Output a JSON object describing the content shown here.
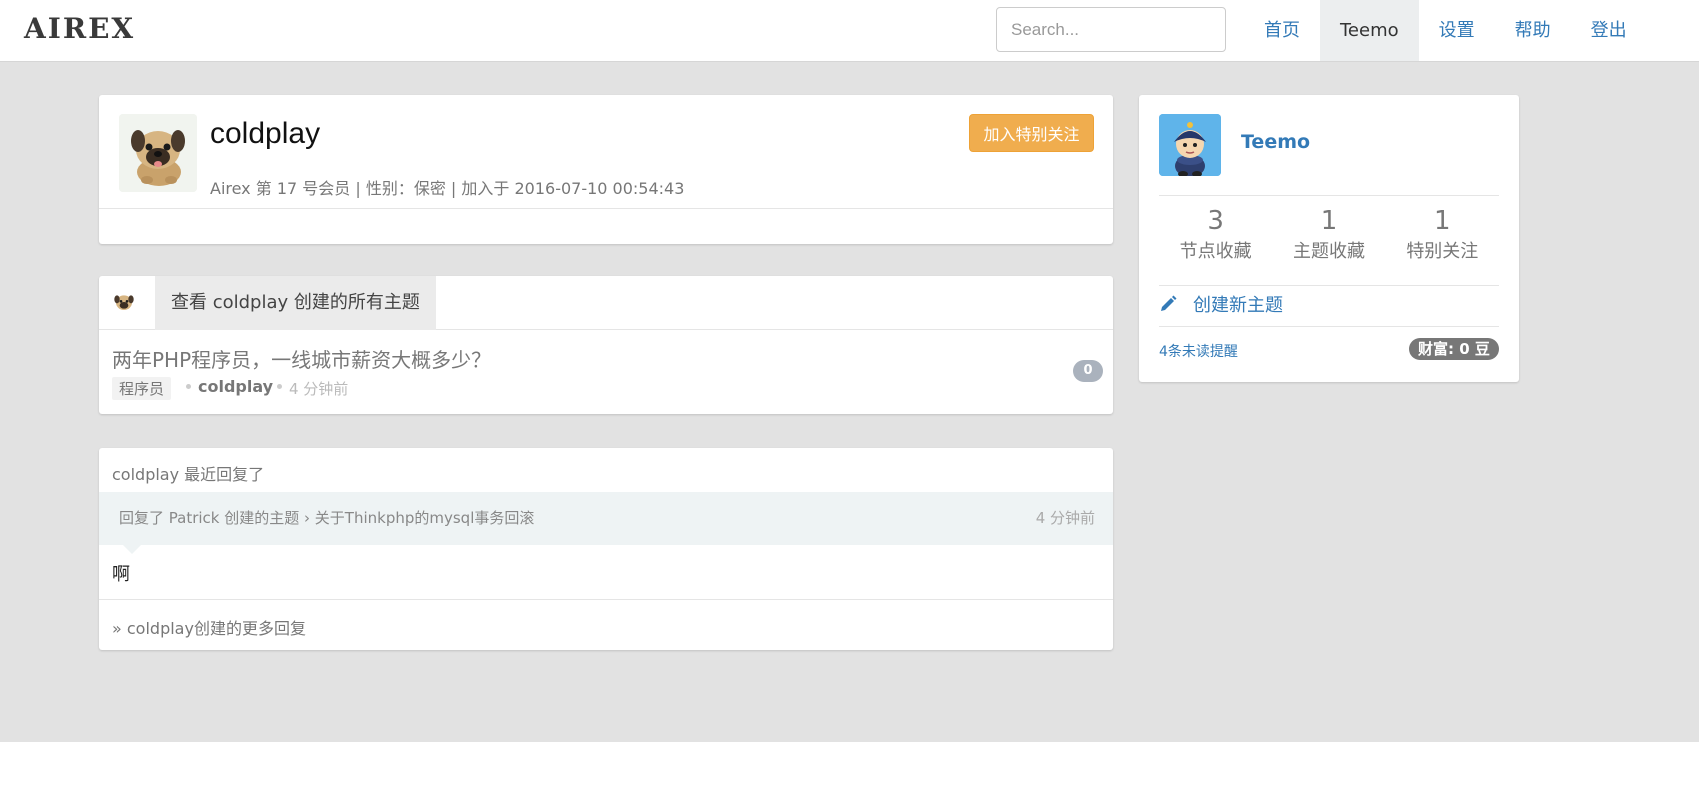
{
  "navbar": {
    "logo": "AIREX",
    "search_placeholder": "Search...",
    "items": [
      {
        "label": "首页",
        "active": false
      },
      {
        "label": "Teemo",
        "active": true
      },
      {
        "label": "设置",
        "active": false
      },
      {
        "label": "帮助",
        "active": false
      },
      {
        "label": "登出",
        "active": false
      }
    ]
  },
  "profile": {
    "username": "coldplay",
    "meta": "Airex 第 17 号会员 | 性别：保密 | 加入于 2016-07-10 00:54:43",
    "follow_button": "加入特别关注",
    "avatar_icon": "pug-avatar-icon"
  },
  "topics": {
    "tab_label": "查看 coldplay 创建的所有主题",
    "items": [
      {
        "title": "两年PHP程序员，一线城市薪资大概多少？",
        "node": "程序员",
        "author": "coldplay",
        "time": "4 分钟前",
        "reply_count": "0"
      }
    ]
  },
  "replies": {
    "header": "coldplay 最近回复了",
    "items": [
      {
        "context": "回复了 Patrick 创建的主题 › 关于Thinkphp的mysql事务回滚",
        "time": "4 分钟前",
        "body": "啊"
      }
    ],
    "more_link": "» coldplay创建的更多回复"
  },
  "sidebar": {
    "username": "Teemo",
    "stats": [
      {
        "value": "3",
        "label": "节点收藏"
      },
      {
        "value": "1",
        "label": "主题收藏"
      },
      {
        "value": "1",
        "label": "特别关注"
      }
    ],
    "create_topic": "创建新主题",
    "create_icon": "pencil-icon",
    "notifications": "4条未读提醒",
    "wealth": "财富: 0 豆"
  },
  "colors": {
    "link": "#337ab7",
    "follow_button": "#f0ad4e",
    "background": "#e2e2e2",
    "badge": "#aab2bd"
  }
}
